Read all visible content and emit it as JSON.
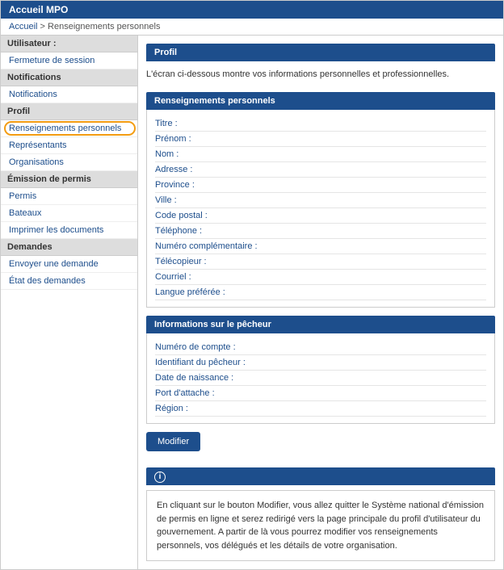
{
  "topbar": {
    "title": "Accueil MPO"
  },
  "breadcrumbs": {
    "home": "Accueil",
    "sep": ">",
    "current": "Renseignements personnels"
  },
  "sidebar": {
    "groups": [
      {
        "head": "Utilisateur :",
        "items": [
          {
            "label": "Fermeture de session"
          }
        ]
      },
      {
        "head": "Notifications",
        "items": [
          {
            "label": "Notifications"
          }
        ]
      },
      {
        "head": "Profil",
        "items": [
          {
            "label": "Renseignements personnels",
            "active": true
          },
          {
            "label": "Représentants"
          },
          {
            "label": "Organisations"
          }
        ]
      },
      {
        "head": "Émission de permis",
        "items": [
          {
            "label": "Permis"
          },
          {
            "label": "Bateaux"
          },
          {
            "label": "Imprimer les documents"
          }
        ]
      },
      {
        "head": "Demandes",
        "items": [
          {
            "label": "Envoyer une demande"
          },
          {
            "label": "État des demandes"
          }
        ]
      }
    ]
  },
  "main": {
    "profil_head": "Profil",
    "intro": "L'écran ci-dessous montre vos informations personnelles et professionnelles.",
    "personal_head": "Renseignements personnels",
    "personal_fields": [
      "Titre :",
      "Prénom :",
      "Nom :",
      "Adresse :",
      "Province :",
      "Ville :",
      "Code postal :",
      "Téléphone :",
      "Numéro complémentaire :",
      "Télécopieur :",
      "Courriel :",
      "Langue préférée :"
    ],
    "fisher_head": "Informations sur le pêcheur",
    "fisher_fields": [
      "Numéro de compte :",
      "Identifiant du pêcheur :",
      "Date de naissance :",
      "Port d'attache :",
      "Région :"
    ],
    "modify_btn": "Modifier",
    "info_icon": "i",
    "info_text": "En cliquant sur le bouton Modifier, vous allez quitter le Système national d'émission de permis en ligne et serez redirigé vers la page principale du profil d'utilisateur du gouvernement. A partir de là vous pourrez modifier vos renseignements personnels, vos délégués et les détails de votre organisation."
  }
}
